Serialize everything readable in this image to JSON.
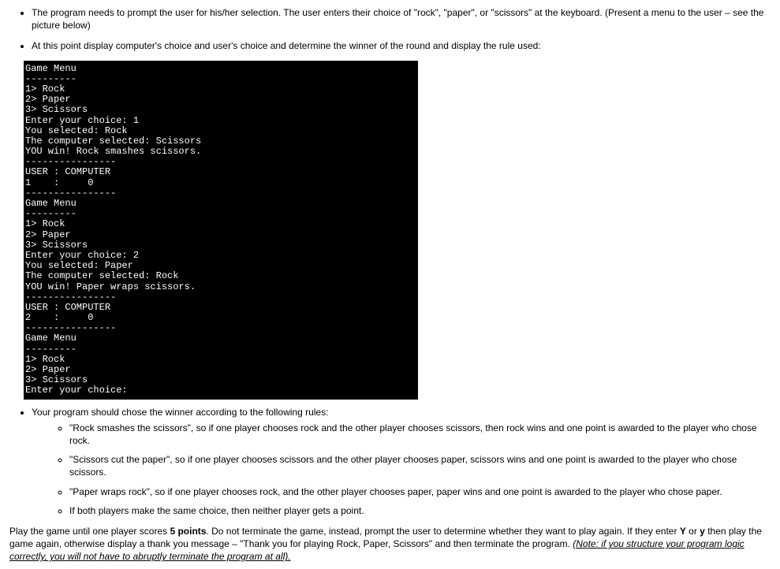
{
  "bullets": {
    "b1": "The program needs to prompt the user for his/her selection. The user enters their choice of \"rock\", \"paper\", or \"scissors\" at the keyboard. (Present a menu to the user – see the picture below)",
    "b2": "At this point display computer's choice and user's choice and determine the winner of the round and display the rule used:",
    "b3": "Your program should chose the winner according to the following rules:"
  },
  "sub_bullets": {
    "s1": "\"Rock smashes the scissors\", so if one player chooses rock and the other player chooses scissors, then rock wins and one point is awarded to the player who chose rock.",
    "s2": "\"Scissors cut the paper\", so if one player chooses scissors and the other player chooses paper, scissors wins and one point is awarded to the player who chose scissors.",
    "s3": "\"Paper wraps rock\", so if one player chooses rock, and the other player chooses paper, paper wins and one point is awarded to the player who chose paper.",
    "s4": "If both players make the same choice, then neither player gets a point."
  },
  "terminal_text": "Game Menu\n---------\n1> Rock\n2> Paper\n3> Scissors\nEnter your choice: 1\nYou selected: Rock\nThe computer selected: Scissors\nYOU win! Rock smashes scissors.\n----------------\nUSER : COMPUTER\n1    :     0\n----------------\nGame Menu\n---------\n1> Rock\n2> Paper\n3> Scissors\nEnter your choice: 2\nYou selected: Paper\nThe computer selected: Rock\nYOU win! Paper wraps scissors.\n----------------\nUSER : COMPUTER\n2    :     0\n----------------\nGame Menu\n---------\n1> Rock\n2> Paper\n3> Scissors\nEnter your choice:",
  "closing": {
    "part1": "Play the game until one player scores ",
    "bold": "5 points",
    "part2": ". Do not terminate the game, instead, prompt the user to determine whether they want to play again. If they enter ",
    "boldY": "Y",
    "part3": " or ",
    "boldy": "y",
    "part4": " then play the game again, otherwise display a thank you message – \"Thank you for playing Rock, Paper, Scissors\" and then terminate the program. ",
    "note": "(Note: if you structure your program logic correctly, you will not have to abruptly terminate the program at all)."
  }
}
